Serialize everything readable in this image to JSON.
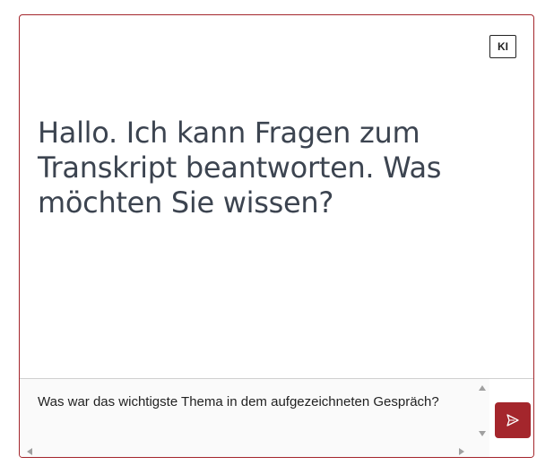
{
  "badge": {
    "label": "KI"
  },
  "assistant": {
    "message": "Hallo. Ich kann Fragen zum Transkript beantworten. Was möchten Sie wissen?"
  },
  "composer": {
    "input_value": "Was war das wichtigste Thema in dem aufgezeichneten Gespräch?",
    "send_icon": "send-icon"
  },
  "colors": {
    "accent": "#a4262c",
    "message_text": "#3c4450",
    "border": "#a4262c"
  }
}
